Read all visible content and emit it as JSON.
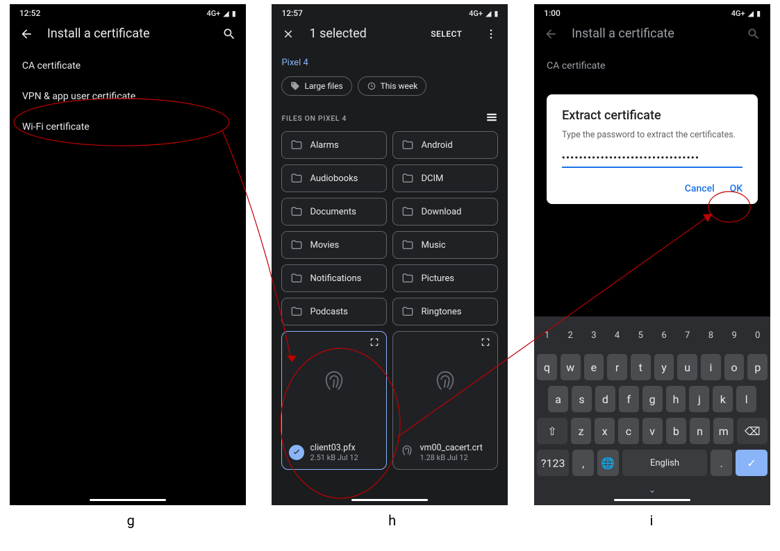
{
  "screen_g": {
    "time": "12:52",
    "net": "4G+",
    "title": "Install a certificate",
    "items": [
      "CA certificate",
      "VPN & app user certificate",
      "Wi-Fi certificate"
    ]
  },
  "screen_h": {
    "time": "12:57",
    "net": "4G+",
    "title": "1 selected",
    "select_label": "SELECT",
    "breadcrumb": "Pixel 4",
    "chips": [
      {
        "icon": "tag",
        "label": "Large files"
      },
      {
        "icon": "history",
        "label": "This week"
      }
    ],
    "section": "FILES ON PIXEL 4",
    "folders": [
      "Alarms",
      "Android",
      "Audiobooks",
      "DCIM",
      "Documents",
      "Download",
      "Movies",
      "Music",
      "Notifications",
      "Pictures",
      "Podcasts",
      "Ringtones"
    ],
    "files": [
      {
        "name": "client03.pfx",
        "sub": "2.51 kB Jul 12",
        "selected": true
      },
      {
        "name": "vm00_cacert.crt",
        "sub": "1.28 kB Jul 12",
        "selected": false
      }
    ]
  },
  "screen_i": {
    "time": "1:00",
    "net": "4G+",
    "title": "Install a certificate",
    "behind_item": "CA certificate",
    "dialog": {
      "title": "Extract certificate",
      "hint": "Type the password to extract the certificates.",
      "password_mask": "••••••••••••••••••••••••••••••••",
      "cancel": "Cancel",
      "ok": "OK"
    },
    "keyboard": {
      "rows_num": [
        "1",
        "2",
        "3",
        "4",
        "5",
        "6",
        "7",
        "8",
        "9",
        "0"
      ],
      "rows_a": [
        "q",
        "w",
        "e",
        "r",
        "t",
        "y",
        "u",
        "i",
        "o",
        "p"
      ],
      "rows_b": [
        "a",
        "s",
        "d",
        "f",
        "g",
        "h",
        "j",
        "k",
        "l"
      ],
      "rows_c": [
        "z",
        "x",
        "c",
        "v",
        "b",
        "n",
        "m"
      ],
      "shift": "⇧",
      "bksp": "⌫",
      "sym": "?123",
      "comma": ",",
      "globe": "🌐",
      "space": "English",
      "period": ".",
      "enter": "✓"
    }
  },
  "labels": {
    "g": "g",
    "h": "h",
    "i": "i"
  }
}
